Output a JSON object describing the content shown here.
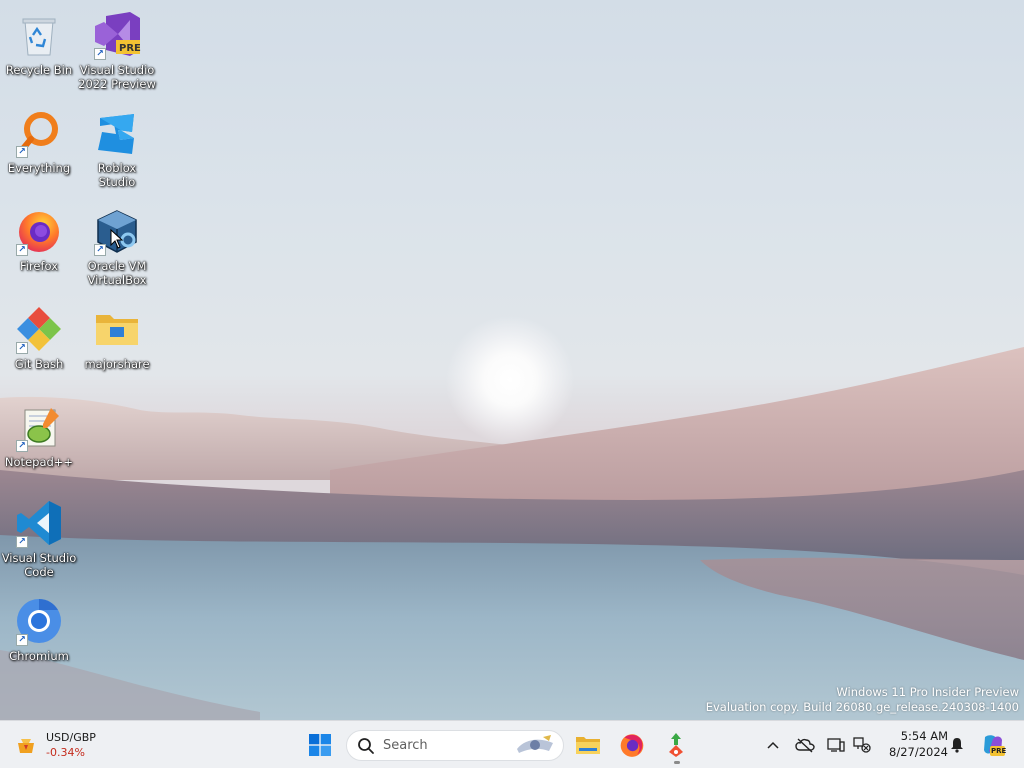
{
  "desktop": {
    "icons": [
      {
        "label": "Recycle Bin",
        "icon": "recycle-bin-icon"
      },
      {
        "label": "Visual Studio 2022 Preview",
        "icon": "visual-studio-icon",
        "badge": "PRE"
      },
      {
        "label": "Everything",
        "icon": "everything-search-icon"
      },
      {
        "label": "Roblox Studio",
        "icon": "roblox-studio-icon"
      },
      {
        "label": "Firefox",
        "icon": "firefox-icon"
      },
      {
        "label": "Oracle VM VirtualBox",
        "icon": "virtualbox-icon"
      },
      {
        "label": "Git Bash",
        "icon": "git-bash-icon"
      },
      {
        "label": "majorshare",
        "icon": "folder-icon"
      },
      {
        "label": "Notepad++",
        "icon": "notepad-plus-plus-icon"
      },
      {
        "label": "Visual Studio Code",
        "icon": "vscode-icon"
      },
      {
        "label": "Chromium",
        "icon": "chromium-icon"
      }
    ],
    "shortcut_glyph": "↗"
  },
  "watermark": {
    "line1": "Windows 11 Pro Insider Preview",
    "line2": "Evaluation copy. Build 26080.ge_release.240308-1400"
  },
  "taskbar": {
    "widget": {
      "title": "USD/GBP",
      "value": "-0.34%",
      "value_color": "#c42b1c",
      "icon": "currency-widget-icon"
    },
    "start": {
      "icon": "windows-start-icon",
      "color": "#0067c0"
    },
    "search": {
      "placeholder": "Search",
      "icon": "search-icon"
    },
    "pinned": [
      "file-explorer-icon",
      "firefox-icon",
      "git-gui-icon"
    ],
    "tray": {
      "icons": [
        "chevron-up-icon",
        "onedrive-offline-icon",
        "display-icon",
        "network-icon"
      ],
      "time": "5:54 AM",
      "date": "8/27/2024",
      "notification_icon": "bell-icon",
      "copilot_badge": "PRE"
    }
  }
}
